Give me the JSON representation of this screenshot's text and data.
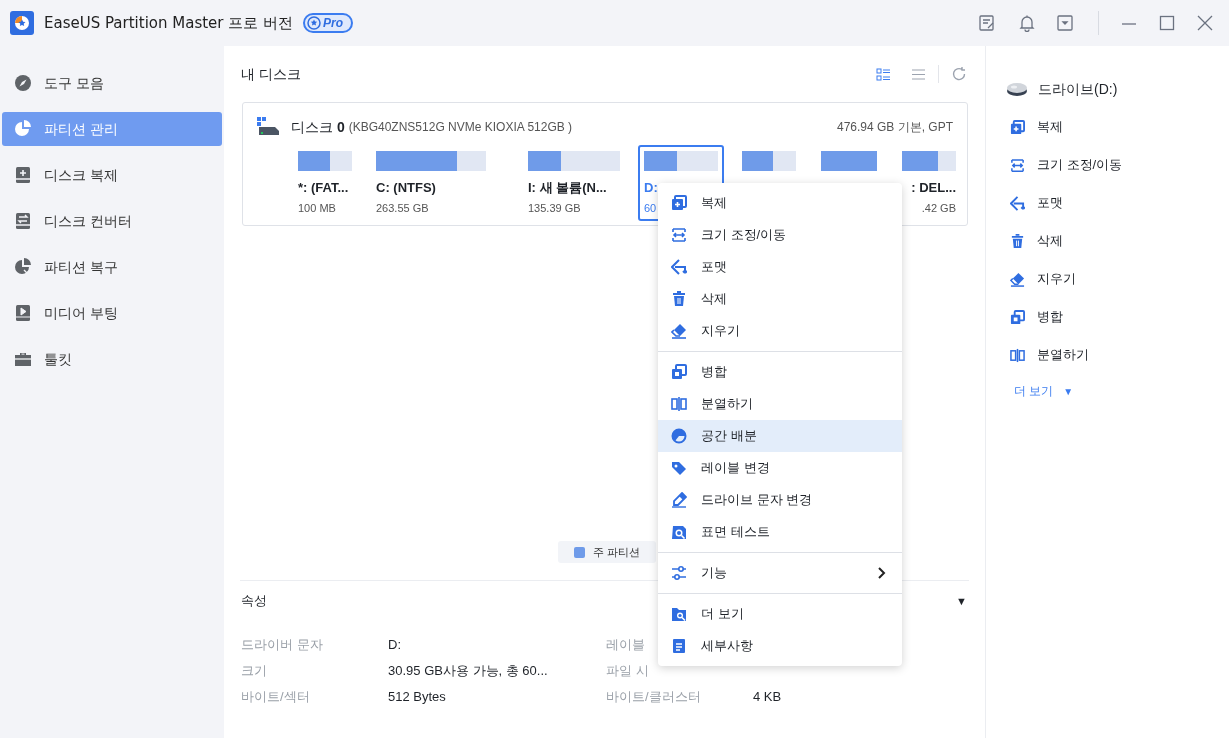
{
  "window": {
    "title": "EaseUS Partition Master 프로 버전",
    "badge": "Pro"
  },
  "sidebar": {
    "items": [
      {
        "label": "도구 모음",
        "selected": false
      },
      {
        "label": "파티션 관리",
        "selected": true
      },
      {
        "label": "디스크 복제",
        "selected": false
      },
      {
        "label": "디스크 컨버터",
        "selected": false
      },
      {
        "label": "파티션 복구",
        "selected": false
      },
      {
        "label": "미디어 부팅",
        "selected": false
      },
      {
        "label": "툴킷",
        "selected": false
      }
    ]
  },
  "main": {
    "title": "내 디스크",
    "views": [
      {
        "selected": true
      },
      {
        "selected": false
      }
    ],
    "disk": {
      "name": "디스크 **0**",
      "model": "(KBG40ZNS512G NVMe KIOXIA 512GB )",
      "info": "476.94 GB 기본, GPT",
      "partitions": [
        {
          "label": "*: (FAT...",
          "size": "100 MB",
          "level": 0.6,
          "selected": false
        },
        {
          "label": "C: (NTFS)",
          "size": "263.55 GB",
          "level": 0.74,
          "selected": false
        },
        {
          "label": "I: 새 볼륨(N...",
          "size": "135.39 GB",
          "level": 0.36,
          "selected": false
        },
        {
          "label": "D:",
          "size": "60",
          "level": 0.45,
          "selected": true
        },
        {
          "level": 0.57,
          "selected": false
        },
        {
          "level": 1.0,
          "selected": false
        },
        {
          "label": ": DEL...",
          "size": ".42 GB",
          "level": 0.67,
          "selected": false
        }
      ]
    },
    "legend": [
      {
        "label": "주 파티션"
      }
    ],
    "properties": {
      "title": "속성",
      "toggle": "▼",
      "rows": [
        {
          "label": "드라이버 문자",
          "value": "D:",
          "label_2": "레이블"
        },
        {
          "label": "크기",
          "value": "30.95 GB사용 가능,  총 60...",
          "label_2": "파일 시"
        },
        {
          "label": "바이트/섹터",
          "value": "512 Bytes",
          "label_2": "바이트/클러스터",
          "value_2": "4 KB"
        }
      ]
    }
  },
  "context_menu": {
    "groups": [
      [
        {
          "label": "복제",
          "selected": false,
          "has_submenu": false
        },
        {
          "label": "크기 조정/이동",
          "selected": false,
          "has_submenu": false
        },
        {
          "label": "포맷",
          "selected": false,
          "has_submenu": false
        },
        {
          "label": "삭제",
          "selected": false,
          "has_submenu": false
        },
        {
          "label": "지우기",
          "selected": false,
          "has_submenu": false
        }
      ],
      [
        {
          "label": "병합",
          "selected": false,
          "has_submenu": false
        },
        {
          "label": "분열하기",
          "selected": false,
          "has_submenu": false
        },
        {
          "label": "공간 배분",
          "selected": true,
          "has_submenu": false
        },
        {
          "label": "레이블 변경",
          "selected": false,
          "has_submenu": false
        },
        {
          "label": "드라이브 문자 변경",
          "selected": false,
          "has_submenu": false
        },
        {
          "label": "표면 테스트",
          "selected": false,
          "has_submenu": false
        }
      ],
      [
        {
          "label": "기능",
          "selected": false,
          "has_submenu": true
        }
      ],
      [
        {
          "label": "더 보기",
          "selected": false,
          "has_submenu": false
        },
        {
          "label": "세부사항",
          "selected": false,
          "has_submenu": false
        }
      ]
    ]
  },
  "right_panel": {
    "drive": "드라이브(D:)",
    "actions": [
      "복제",
      "크기 조정/이동",
      "포맷",
      "삭제",
      "지우기",
      "병합",
      "분열하기"
    ],
    "more": "더 보기",
    "more_arrow": "▼"
  }
}
